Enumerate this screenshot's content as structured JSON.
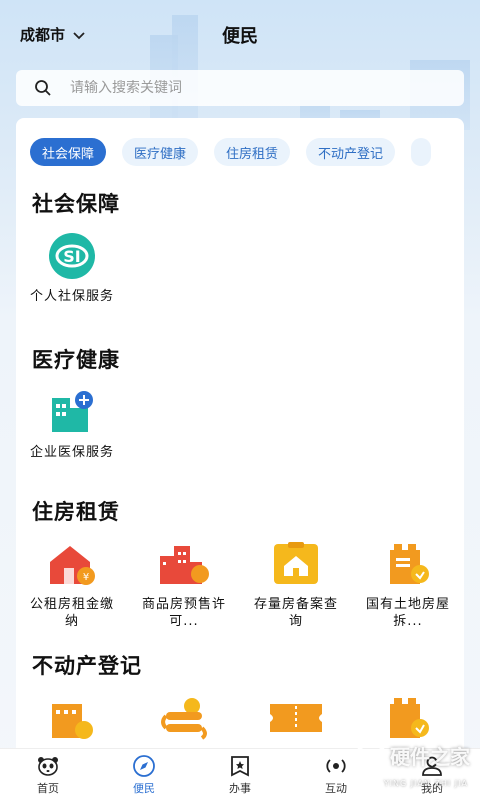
{
  "header": {
    "city": "成都市",
    "title": "便民"
  },
  "search": {
    "placeholder": "请输入搜索关键词"
  },
  "tabs": [
    {
      "label": "社会保障",
      "active": true
    },
    {
      "label": "医疗健康",
      "active": false
    },
    {
      "label": "住房租赁",
      "active": false
    },
    {
      "label": "不动产登记",
      "active": false
    }
  ],
  "sections": [
    {
      "title": "社会保障",
      "items": [
        {
          "label": "个人社保服务",
          "icon": "social-insurance-icon"
        }
      ]
    },
    {
      "title": "医疗健康",
      "items": [
        {
          "label": "企业医保服务",
          "icon": "medical-insurance-icon"
        }
      ]
    },
    {
      "title": "住房租赁",
      "items": [
        {
          "label": "公租房租金缴纳",
          "icon": "public-housing-rent-icon"
        },
        {
          "label": "商品房预售许可...",
          "icon": "presale-permit-icon"
        },
        {
          "label": "存量房备案查询",
          "icon": "house-record-query-icon"
        },
        {
          "label": "国有土地房屋拆...",
          "icon": "land-demolition-icon"
        }
      ]
    },
    {
      "title": "不动产登记",
      "items": [
        {
          "label": "",
          "icon": "property-building-icon"
        },
        {
          "label": "",
          "icon": "property-exchange-icon"
        },
        {
          "label": "",
          "icon": "property-ticket-icon"
        },
        {
          "label": "",
          "icon": "property-verified-icon"
        }
      ]
    }
  ],
  "bottom_nav": [
    {
      "label": "首页",
      "icon": "home-panda-icon",
      "active": false
    },
    {
      "label": "便民",
      "icon": "compass-icon",
      "active": true
    },
    {
      "label": "办事",
      "icon": "bookmark-star-icon",
      "active": false
    },
    {
      "label": "互动",
      "icon": "interact-icon",
      "active": false
    },
    {
      "label": "我的",
      "icon": "user-icon",
      "active": false
    }
  ],
  "colors": {
    "primary": "#2b6fd1",
    "orange": "#f29a1f",
    "red": "#e8493a",
    "teal": "#1fb8a6"
  },
  "watermark": {
    "text": "硬件之家",
    "sub": "YING JIAN ZHI JIA"
  }
}
